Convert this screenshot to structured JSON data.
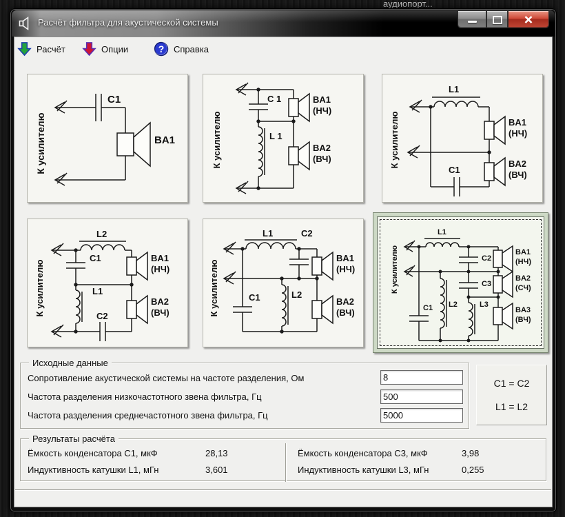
{
  "desktop": {
    "background_window_title": "аудиопорт..."
  },
  "window": {
    "title": "Расчёт фильтра для акустической системы",
    "icons": {
      "app": "speaker-icon",
      "minimize": "minimize-icon",
      "maximize": "maximize-icon",
      "close": "close-icon"
    }
  },
  "toolbar": {
    "items": [
      {
        "label": "Расчёт",
        "icon": "green-down-arrow-icon"
      },
      {
        "label": "Опции",
        "icon": "red-down-arrow-icon"
      },
      {
        "label": "Справка",
        "icon": "blue-help-circle-icon",
        "glyph": "?"
      }
    ]
  },
  "diagrams": {
    "amp_label": "К усилителю",
    "d1": {
      "c1": "C1",
      "ba1": "BA1"
    },
    "d2": {
      "c1": "C 1",
      "l1": "L 1",
      "ba1": "BA1",
      "ba1_band": "(НЧ)",
      "ba2": "BA2",
      "ba2_band": "(ВЧ)"
    },
    "d3": {
      "l1": "L1",
      "c1": "C1",
      "ba1": "BA1",
      "ba1_band": "(НЧ)",
      "ba2": "BA2",
      "ba2_band": "(ВЧ)"
    },
    "d4": {
      "l2": "L2",
      "c1": "C1",
      "l1": "L1",
      "c2": "C2",
      "ba1": "BA1",
      "ba1_band": "(НЧ)",
      "ba2": "BA2",
      "ba2_band": "(ВЧ)"
    },
    "d5": {
      "l1": "L1",
      "c2": "C2",
      "c1": "C1",
      "l2": "L2",
      "ba1": "BA1",
      "ba1_band": "(НЧ)",
      "ba2": "BA2",
      "ba2_band": "(ВЧ)"
    },
    "d6": {
      "l1": "L1",
      "c2": "C2",
      "c3": "C3",
      "c1": "C1",
      "l2": "L2",
      "l3": "L3",
      "ba1": "BA1",
      "ba1_band": "(НЧ)",
      "ba2": "BA2",
      "ba2_band": "(СЧ)",
      "ba3": "BA3",
      "ba3_band": "(ВЧ)"
    }
  },
  "inputs": {
    "group_title": "Исходные данные",
    "rows": [
      {
        "label": "Сопротивление акустической системы на частоте разделения, Ом",
        "value": "8"
      },
      {
        "label": "Частота разделения низкочастотного звена фильтра, Гц",
        "value": "500"
      },
      {
        "label": "Частота разделения среднечастотного звена фильтра, Гц",
        "value": "5000"
      }
    ]
  },
  "equalities": {
    "line1": "C1 = C2",
    "line2": "L1 = L2"
  },
  "results": {
    "group_title": "Результаты расчёта",
    "left": [
      {
        "label": "Ёмкость конденсатора C1, мкФ",
        "value": "28,13"
      },
      {
        "label": "Индуктивность катушки L1, мГн",
        "value": "3,601"
      }
    ],
    "right": [
      {
        "label": "Ёмкость конденсатора C3, мкФ",
        "value": "3,98"
      },
      {
        "label": "Индуктивность катушки L3, мГн",
        "value": "0,255"
      }
    ]
  },
  "statusbar": {
    "text": ""
  }
}
